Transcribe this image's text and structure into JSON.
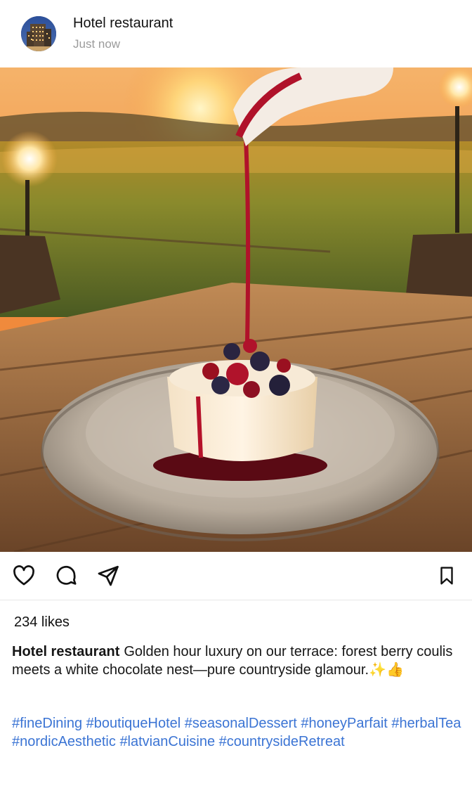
{
  "post": {
    "account_name": "Hotel restaurant",
    "timestamp": "Just now",
    "likes": "234 likes",
    "caption_author": "Hotel restaurant",
    "caption_text": "Golden hour luxury on our terrace: forest berry coulis meets a white chocolate nest—pure countryside glamour.✨👍",
    "hashtags": [
      "#fineDining",
      "#boutiqueHotel",
      "#seasonalDessert",
      "#honeyParfait",
      "#herbalTea",
      "#nordicAesthetic",
      "#latvianCuisine",
      "#countrysideRetreat"
    ]
  },
  "icons": {
    "avatar": "hotel-building-avatar",
    "like": "heart-icon",
    "comment": "comment-bubble-icon",
    "share": "paper-plane-icon",
    "save": "bookmark-icon"
  },
  "colors": {
    "hashtag": "#3b74d4",
    "secondary_text": "#9b9b9b",
    "divider": "#e6e6e6"
  }
}
